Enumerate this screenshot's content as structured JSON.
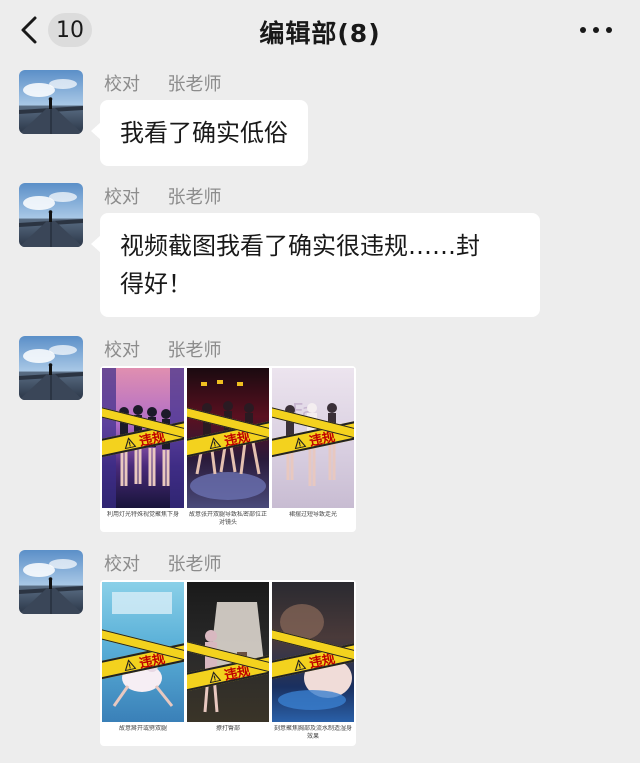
{
  "header": {
    "back_count": "10",
    "title": "编辑部(8)"
  },
  "messages": [
    {
      "sender": "校对  张老师",
      "text": "我看了确实低俗"
    },
    {
      "sender": "校对  张老师",
      "text_line1": "视频截图我看了确实很违规……封",
      "text_line2": "得好！"
    },
    {
      "sender": "校对  张老师",
      "images": [
        {
          "stamp": "违规",
          "caption": "利用灯光特殊视觉聚焦下身"
        },
        {
          "stamp": "违规",
          "caption": "故意张开双腿导致私密部位正对镜头"
        },
        {
          "stamp": "违规",
          "caption": "裙摆过短导致走光"
        }
      ]
    },
    {
      "sender": "校对  张老师",
      "images": [
        {
          "stamp": "违规",
          "caption": "故意掰开或劈双腿"
        },
        {
          "stamp": "违规",
          "caption": "撩打臀部"
        },
        {
          "stamp": "违规",
          "caption": "刻意聚焦胸部及流水制造湿身效果"
        }
      ]
    }
  ],
  "colors": {
    "background": "#ededed",
    "bubble": "#ffffff",
    "sender_name": "#8c8c8c",
    "tape": "#f3d21e",
    "stamp_text": "#c00000"
  },
  "icons": [
    "back-chevron-icon",
    "more-icon",
    "warning-icon"
  ]
}
